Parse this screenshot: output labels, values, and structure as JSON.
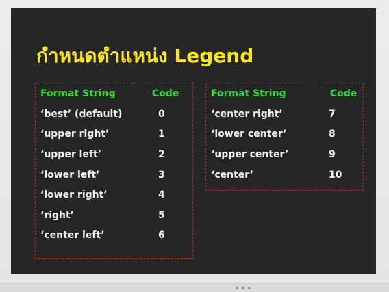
{
  "slide": {
    "title": "กำหนดตำแหน่ง Legend",
    "colors": {
      "background": "#262626",
      "title": "#ffe81a",
      "header": "#2fdc37",
      "text": "#f2f2f2",
      "border": "#b22b2b"
    }
  },
  "tables": {
    "left": {
      "header": {
        "format": "Format String",
        "code": "Code"
      },
      "rows": [
        {
          "format": "‘best’ (default)",
          "code": "0"
        },
        {
          "format": "‘upper right’",
          "code": "1"
        },
        {
          "format": "‘upper left’",
          "code": "2"
        },
        {
          "format": "‘lower left’",
          "code": "3"
        },
        {
          "format": "‘lower right’",
          "code": "4"
        },
        {
          "format": "‘right’",
          "code": "5"
        },
        {
          "format": "‘center left’",
          "code": "6"
        }
      ]
    },
    "right": {
      "header": {
        "format": "Format String",
        "code": "Code"
      },
      "rows": [
        {
          "format": "‘center right’",
          "code": "7"
        },
        {
          "format": "‘lower center’",
          "code": "8"
        },
        {
          "format": "‘upper center’",
          "code": "9"
        },
        {
          "format": "‘center’",
          "code": "10"
        }
      ]
    }
  }
}
